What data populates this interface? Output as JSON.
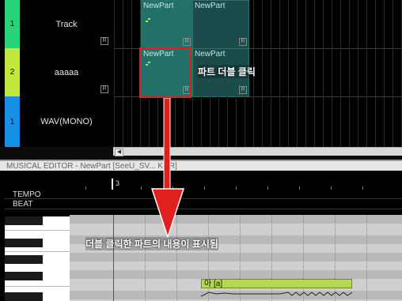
{
  "tracks": [
    {
      "number": "1",
      "name": "Track",
      "color": "#27d47a"
    },
    {
      "number": "2",
      "name": "aaaaa",
      "color": "#c4e63b"
    },
    {
      "number": "1",
      "name": "WAV(MONO)",
      "color": "#1690e6"
    }
  ],
  "parts": {
    "label": "NewPart",
    "badge": "R"
  },
  "editor": {
    "title": "MUSICAL EDITOR - NewPart [SeeU_SV... KOR]",
    "tempo_label": "TEMPO",
    "beat_label": "BEAT",
    "measure": "3",
    "note_lyric": "아 [a]"
  },
  "annotations": {
    "double_click": "파트 더블 클릭",
    "shown_content": "더블 클릭한 파트의 내용이 표시됨"
  },
  "colors": {
    "accent_red": "#e01f1f",
    "part_teal": "#1b4b4a",
    "note_green": "#b4d84f"
  }
}
